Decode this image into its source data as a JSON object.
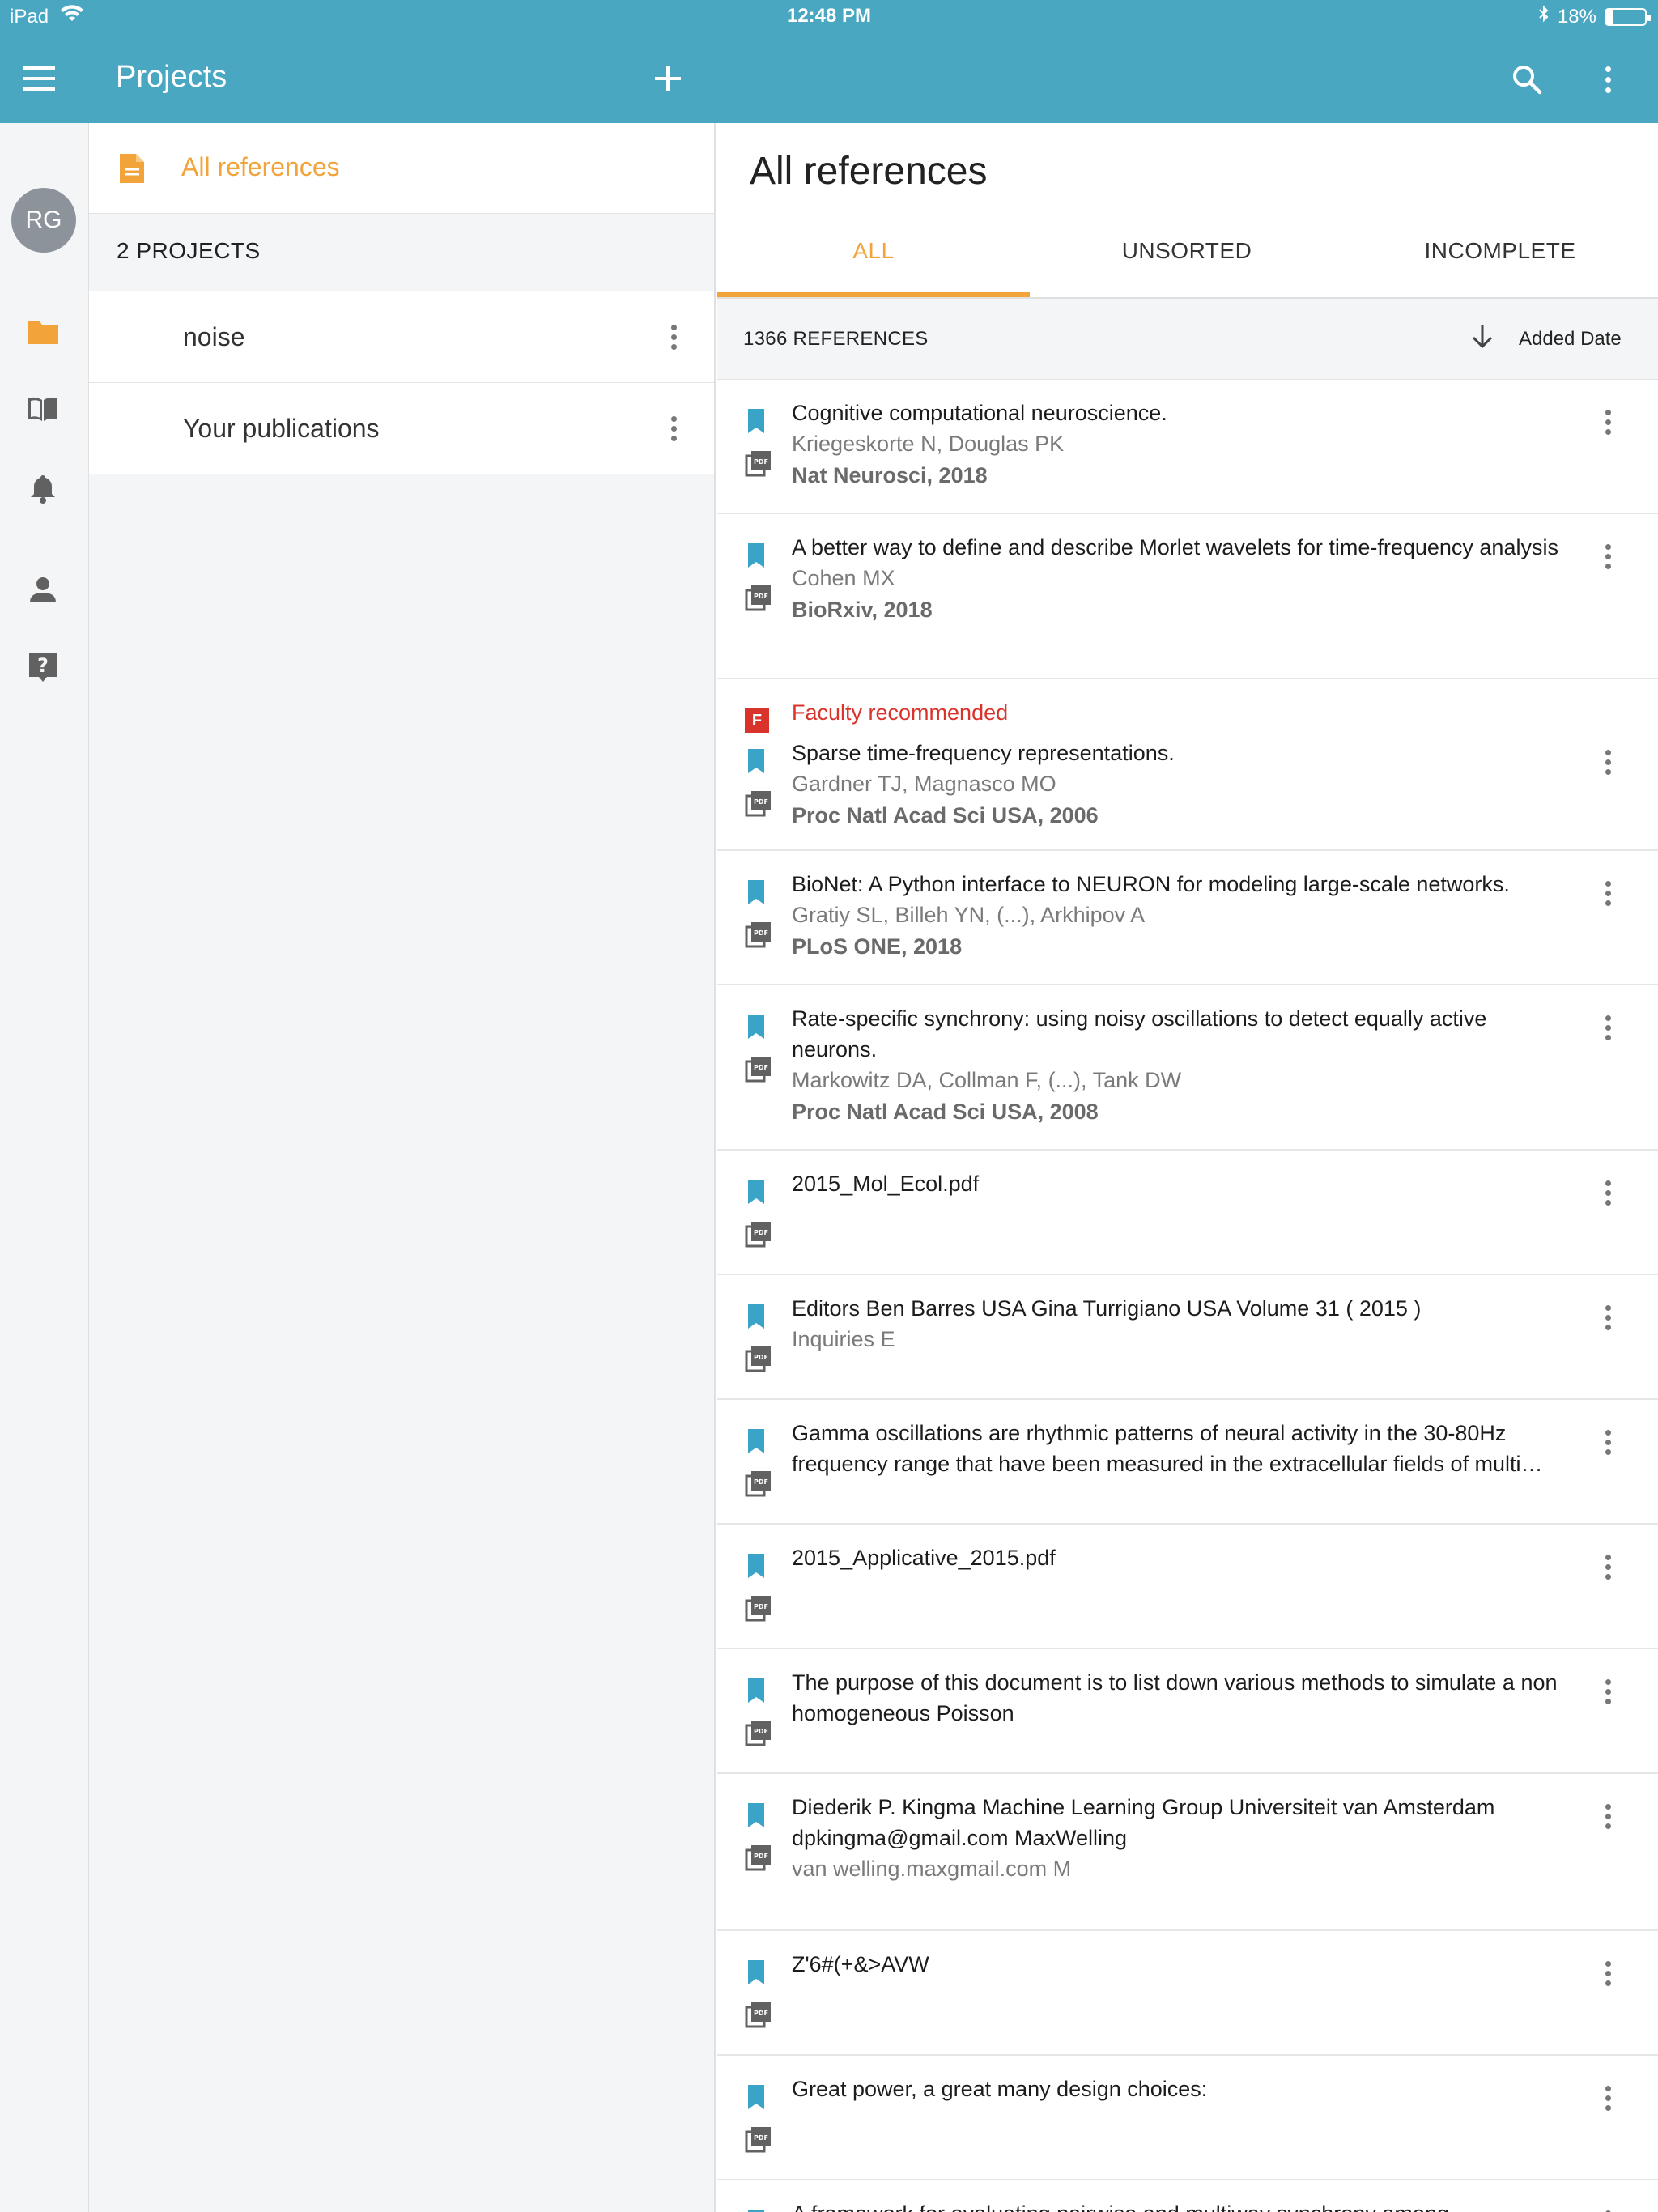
{
  "status_bar": {
    "device": "iPad",
    "time": "12:48 PM",
    "battery": "18%",
    "battery_level": 0.18
  },
  "app_bar": {
    "title": "Projects"
  },
  "rail": {
    "avatar_initials": "RG"
  },
  "projects_panel": {
    "all_references_label": "All references",
    "projects_count_label": "2 PROJECTS",
    "projects": [
      {
        "name": "noise"
      },
      {
        "name": "Your publications"
      }
    ]
  },
  "main": {
    "title": "All references",
    "tabs": [
      {
        "label": "ALL",
        "active": true
      },
      {
        "label": "UNSORTED",
        "active": false
      },
      {
        "label": "INCOMPLETE",
        "active": false
      }
    ],
    "references_count": "1366 REFERENCES",
    "sort_label": "Added Date",
    "references": [
      {
        "title": "Cognitive computational neuroscience.",
        "authors": "Kriegeskorte N, Douglas PK",
        "journal": "Nat Neurosci, 2018"
      },
      {
        "title": "A better way to define and describe Morlet wavelets for time-frequency analysis",
        "authors": "Cohen MX",
        "journal": "BioRxiv, 2018"
      },
      {
        "faculty": "Faculty recommended",
        "title": "Sparse time-frequency representations.",
        "authors": "Gardner TJ, Magnasco MO",
        "journal": "Proc Natl Acad Sci USA, 2006"
      },
      {
        "title": "BioNet: A Python interface to NEURON for modeling large-scale networks.",
        "authors": "Gratiy SL, Billeh YN, (...), Arkhipov A",
        "journal": "PLoS ONE, 2018"
      },
      {
        "title": "Rate-specific synchrony: using noisy oscillations to detect equally active neurons.",
        "authors": "Markowitz DA, Collman F, (...), Tank DW",
        "journal": "Proc Natl Acad Sci USA, 2008"
      },
      {
        "title": "2015_Mol_Ecol.pdf"
      },
      {
        "title": "Editors Ben Barres USA Gina Turrigiano USA Volume  31 ( 2015 )",
        "authors": "Inquiries E"
      },
      {
        "title": "Gamma oscillations are rhythmic patterns of neural activity in the 30-80Hz frequency range that have been measured in the extracellular fields of multi…"
      },
      {
        "title": "2015_Applicative_2015.pdf"
      },
      {
        "title": "The purpose of this document is to list down various methods to simulate a non homogeneous Poisson"
      },
      {
        "title": "Diederik P. Kingma Machine Learning Group Universiteit van Amsterdam dpkingma@gmail.com MaxWelling",
        "authors": "van welling.maxgmail.com M"
      },
      {
        "title": "Z'6#(+&>AVW"
      },
      {
        "title": "Great power, a great many design choices:"
      },
      {
        "title": "A framework for evaluating pairwise and multiway synchrony among"
      }
    ]
  },
  "colors": {
    "app_bar": "#4aa7c1",
    "accent": "#f2a33a",
    "bookmark": "#3aa3c8",
    "faculty_red": "#d9342b"
  }
}
